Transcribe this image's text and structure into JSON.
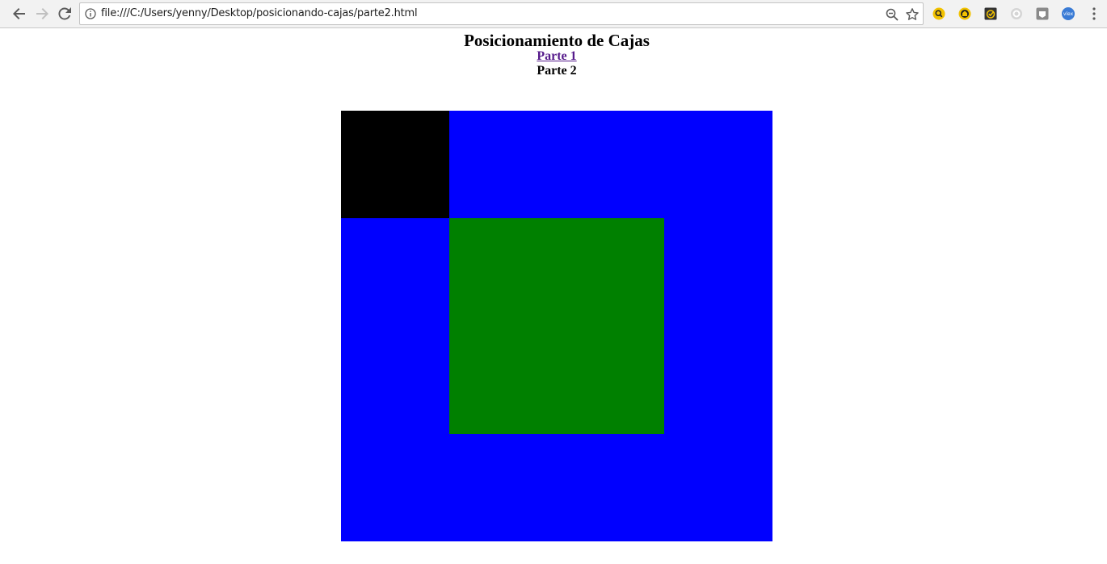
{
  "browser": {
    "url": "file:///C:/Users/yenny/Desktop/posicionando-cajas/parte2.html",
    "icons": {
      "back": "arrow-left-icon",
      "forward": "arrow-right-icon",
      "reload": "reload-icon",
      "info": "info-icon",
      "zoom": "zoom-out-icon",
      "bookmark": "star-icon",
      "menu": "kebab-menu-icon"
    },
    "extensions": [
      {
        "name": "yellow-search-extension-icon",
        "color": "#f2c200"
      },
      {
        "name": "yellow-home-extension-icon",
        "color": "#f2c200"
      },
      {
        "name": "checkmark-extension-icon",
        "color": "#333333"
      },
      {
        "name": "gray-circle-extension-icon",
        "color": "#bbbbbb"
      },
      {
        "name": "gray-square-extension-icon",
        "color": "#888888"
      },
      {
        "name": "vlex-extension-icon",
        "label": "vlex",
        "color": "#3a7bd5"
      }
    ]
  },
  "page": {
    "title": "Posicionamiento de Cajas",
    "nav": {
      "parte1": "Parte 1",
      "parte2": "Parte 2"
    },
    "boxes": {
      "outer_color": "#0000ff",
      "corner_color": "#000000",
      "inner_color": "#008000"
    }
  }
}
